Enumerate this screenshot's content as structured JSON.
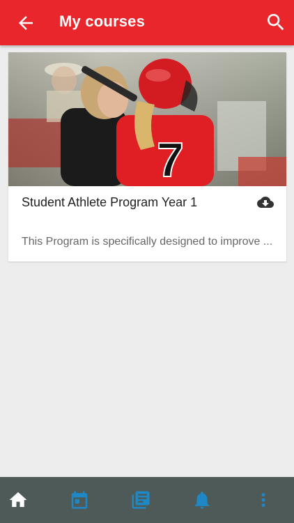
{
  "header": {
    "title": "My courses",
    "back_icon": "arrow-back-icon",
    "search_icon": "search-icon",
    "color": "#e8262c"
  },
  "course": {
    "title": "Student Athlete Program Year 1",
    "description": "This Program is specifically designed to improve ...",
    "image_alt": "softball player and coach",
    "download_icon": "cloud-download-icon"
  },
  "bottom_nav": {
    "items": [
      {
        "icon": "home-icon",
        "active": true
      },
      {
        "icon": "calendar-icon",
        "active": false
      },
      {
        "icon": "library-icon",
        "active": false
      },
      {
        "icon": "bell-icon",
        "active": false
      },
      {
        "icon": "more-vert-icon",
        "active": false
      }
    ],
    "background": "#4d5a57",
    "active_color": "#ffffff",
    "inactive_color": "#1e88c7"
  }
}
